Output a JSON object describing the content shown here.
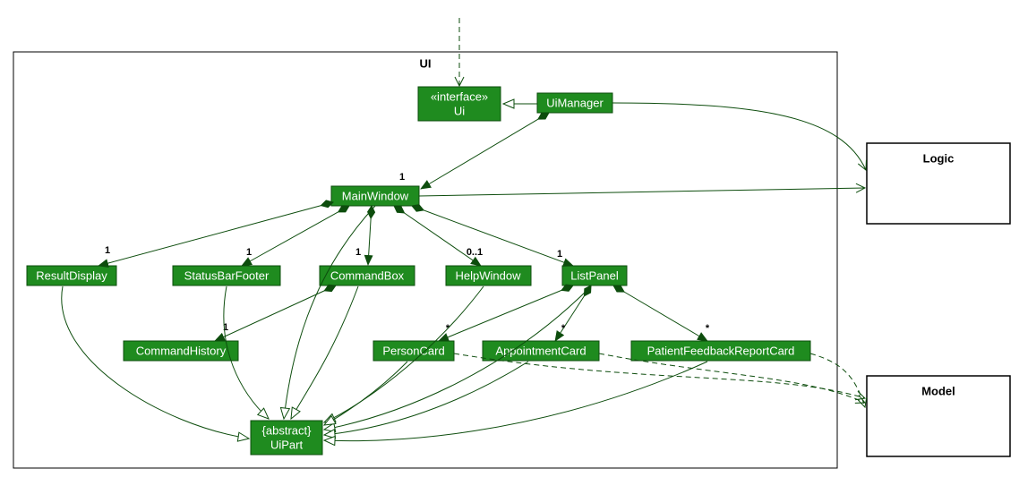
{
  "diagram": {
    "package": {
      "name": "UI"
    },
    "externals": {
      "logic": "Logic",
      "model": "Model"
    },
    "nodes": {
      "ui_iface": {
        "stereo": "«interface»",
        "name": "Ui"
      },
      "uimanager": "UiManager",
      "mainwindow": "MainWindow",
      "resultdisplay": "ResultDisplay",
      "statusbar": "StatusBarFooter",
      "commandbox": "CommandBox",
      "helpwindow": "HelpWindow",
      "listpanel": "ListPanel",
      "commandhistory": "CommandHistory",
      "personcard": "PersonCard",
      "appointmentcard": "AppointmentCard",
      "feedbackcard": "PatientFeedbackReportCard",
      "uipart": {
        "stereo": "{abstract}",
        "name": "UiPart"
      }
    },
    "mults": {
      "mw": "1",
      "rd": "1",
      "sb": "1",
      "cb": "1",
      "hw": "0..1",
      "lp": "1",
      "ch": "1",
      "pc": "*",
      "ac": "*",
      "fc": "*"
    }
  },
  "chart_data": {
    "type": "uml-class-diagram",
    "packages": [
      {
        "name": "UI",
        "contains": [
          "Ui",
          "UiManager",
          "MainWindow",
          "ResultDisplay",
          "StatusBarFooter",
          "CommandBox",
          "HelpWindow",
          "ListPanel",
          "CommandHistory",
          "PersonCard",
          "AppointmentCard",
          "PatientFeedbackReportCard",
          "UiPart"
        ]
      }
    ],
    "external_components": [
      "Logic",
      "Model"
    ],
    "classes": [
      {
        "name": "Ui",
        "stereotype": "interface"
      },
      {
        "name": "UiManager"
      },
      {
        "name": "MainWindow"
      },
      {
        "name": "ResultDisplay"
      },
      {
        "name": "StatusBarFooter"
      },
      {
        "name": "CommandBox"
      },
      {
        "name": "HelpWindow"
      },
      {
        "name": "ListPanel"
      },
      {
        "name": "CommandHistory"
      },
      {
        "name": "PersonCard"
      },
      {
        "name": "AppointmentCard"
      },
      {
        "name": "PatientFeedbackReportCard"
      },
      {
        "name": "UiPart",
        "stereotype": "abstract"
      }
    ],
    "relationships": [
      {
        "from": "(external)",
        "to": "Ui",
        "type": "dependency"
      },
      {
        "from": "UiManager",
        "to": "Ui",
        "type": "realization"
      },
      {
        "from": "UiManager",
        "to": "MainWindow",
        "type": "composition",
        "multiplicity": "1"
      },
      {
        "from": "UiManager",
        "to": "Logic",
        "type": "association-nav"
      },
      {
        "from": "MainWindow",
        "to": "Logic",
        "type": "association-nav"
      },
      {
        "from": "MainWindow",
        "to": "ResultDisplay",
        "type": "composition",
        "multiplicity": "1"
      },
      {
        "from": "MainWindow",
        "to": "StatusBarFooter",
        "type": "composition",
        "multiplicity": "1"
      },
      {
        "from": "MainWindow",
        "to": "CommandBox",
        "type": "composition",
        "multiplicity": "1"
      },
      {
        "from": "MainWindow",
        "to": "HelpWindow",
        "type": "composition",
        "multiplicity": "0..1"
      },
      {
        "from": "MainWindow",
        "to": "ListPanel",
        "type": "composition",
        "multiplicity": "1"
      },
      {
        "from": "CommandBox",
        "to": "CommandHistory",
        "type": "composition",
        "multiplicity": "1"
      },
      {
        "from": "ListPanel",
        "to": "PersonCard",
        "type": "composition",
        "multiplicity": "*"
      },
      {
        "from": "ListPanel",
        "to": "AppointmentCard",
        "type": "composition",
        "multiplicity": "*"
      },
      {
        "from": "ListPanel",
        "to": "PatientFeedbackReportCard",
        "type": "composition",
        "multiplicity": "*"
      },
      {
        "from": "MainWindow",
        "to": "UiPart",
        "type": "generalization"
      },
      {
        "from": "ResultDisplay",
        "to": "UiPart",
        "type": "generalization"
      },
      {
        "from": "StatusBarFooter",
        "to": "UiPart",
        "type": "generalization"
      },
      {
        "from": "CommandBox",
        "to": "UiPart",
        "type": "generalization"
      },
      {
        "from": "HelpWindow",
        "to": "UiPart",
        "type": "generalization"
      },
      {
        "from": "ListPanel",
        "to": "UiPart",
        "type": "generalization"
      },
      {
        "from": "PersonCard",
        "to": "UiPart",
        "type": "generalization"
      },
      {
        "from": "AppointmentCard",
        "to": "UiPart",
        "type": "generalization"
      },
      {
        "from": "PatientFeedbackReportCard",
        "to": "UiPart",
        "type": "generalization"
      },
      {
        "from": "PersonCard",
        "to": "Model",
        "type": "dependency"
      },
      {
        "from": "AppointmentCard",
        "to": "Model",
        "type": "dependency"
      },
      {
        "from": "PatientFeedbackReportCard",
        "to": "Model",
        "type": "dependency"
      }
    ]
  }
}
